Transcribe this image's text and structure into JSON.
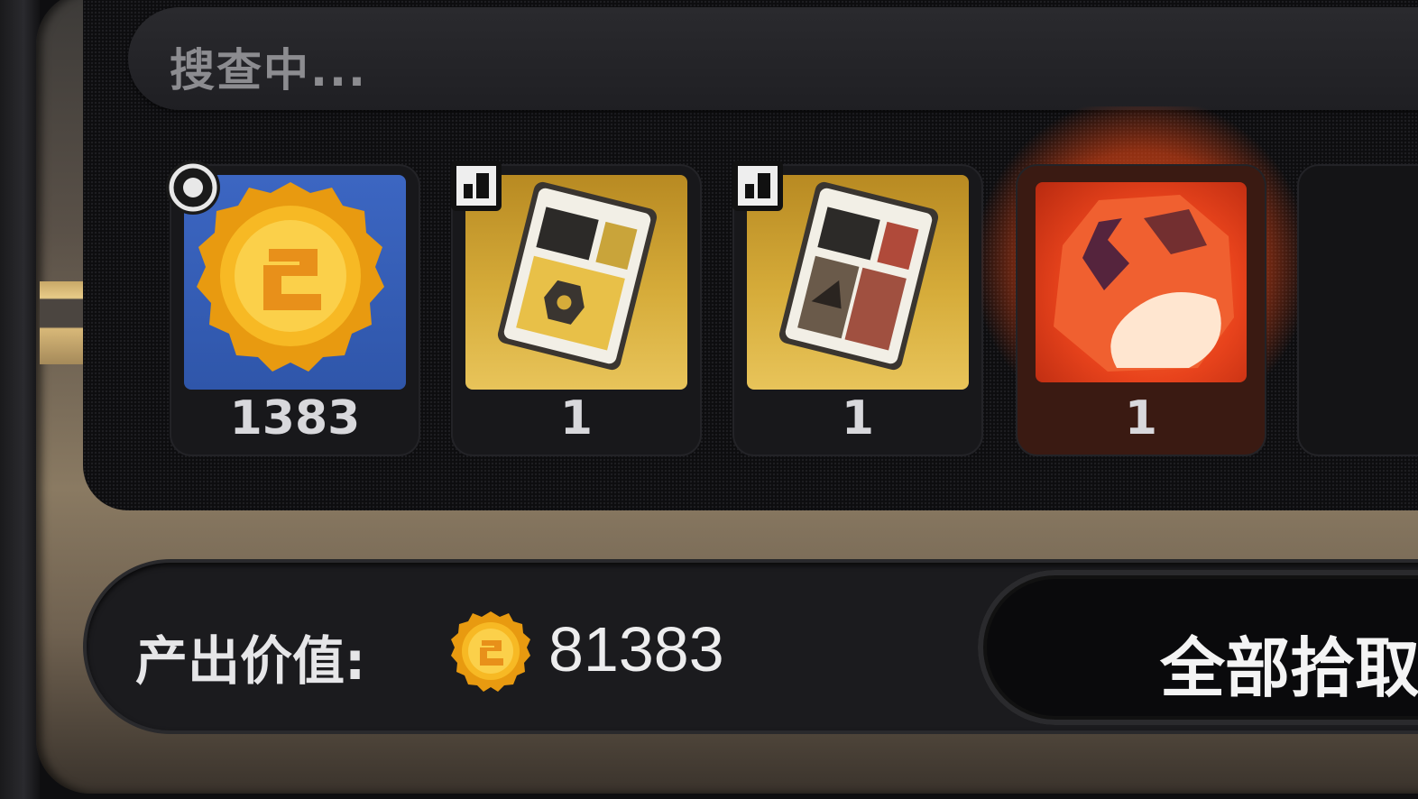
{
  "search": {
    "status_text": "搜查中..."
  },
  "items": [
    {
      "name": "coin",
      "count": "1383",
      "badge": "coin-badge-icon",
      "bg": "blue"
    },
    {
      "name": "document",
      "count": "1",
      "badge": "document-badge-icon",
      "bg": "gold"
    },
    {
      "name": "document",
      "count": "1",
      "badge": "document-badge-icon",
      "bg": "gold"
    },
    {
      "name": "ore",
      "count": "1",
      "badge": "",
      "bg": "red"
    }
  ],
  "footer": {
    "value_label": "产出价值:",
    "value_amount": "81383",
    "collect_button_label": "全部拾取"
  },
  "colors": {
    "frame_bronze": "#8a7a62",
    "coin_gold": "#f0b020",
    "slot_blue": "#3c66c2",
    "slot_gold": "#d6ac3a",
    "slot_red": "#e8431c"
  }
}
